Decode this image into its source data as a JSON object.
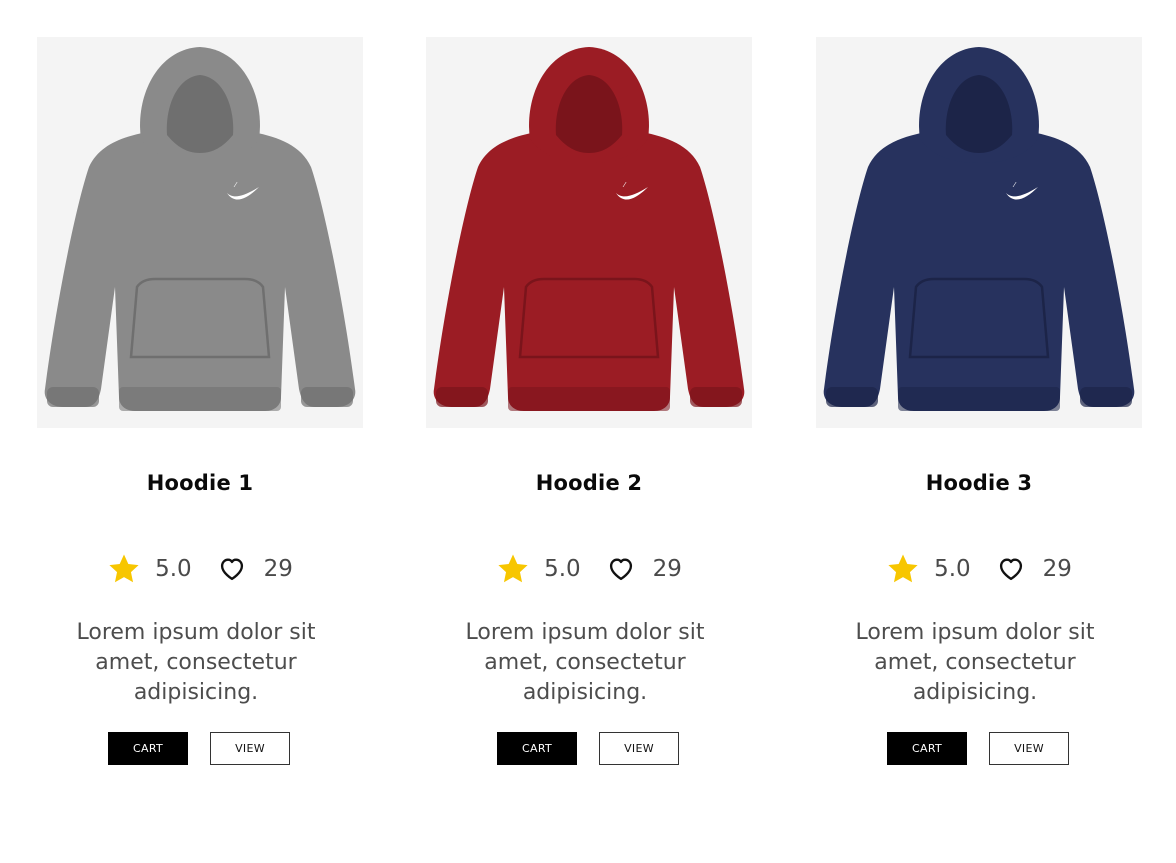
{
  "products": [
    {
      "title": "Hoodie 1",
      "rating": "5.0",
      "likes": "29",
      "description": "Lorem ipsum dolor sit amet, consectetur adipisicing.",
      "cart_label": "CART",
      "view_label": "VIEW",
      "color": "#8a8a8a",
      "shade": "#6f6f6f"
    },
    {
      "title": "Hoodie 2",
      "rating": "5.0",
      "likes": "29",
      "description": "Lorem ipsum dolor sit amet, consectetur adipisicing.",
      "cart_label": "CART",
      "view_label": "VIEW",
      "color": "#9b1c24",
      "shade": "#7a141b"
    },
    {
      "title": "Hoodie 3",
      "rating": "5.0",
      "likes": "29",
      "description": "Lorem ipsum dolor sit amet, consectetur adipisicing.",
      "cart_label": "CART",
      "view_label": "VIEW",
      "color": "#27325e",
      "shade": "#1c2448"
    }
  ],
  "icons": {
    "rating": "star-icon",
    "likes": "heart-icon"
  },
  "colors": {
    "star": "#f7c600",
    "cart_bg": "#000000"
  }
}
